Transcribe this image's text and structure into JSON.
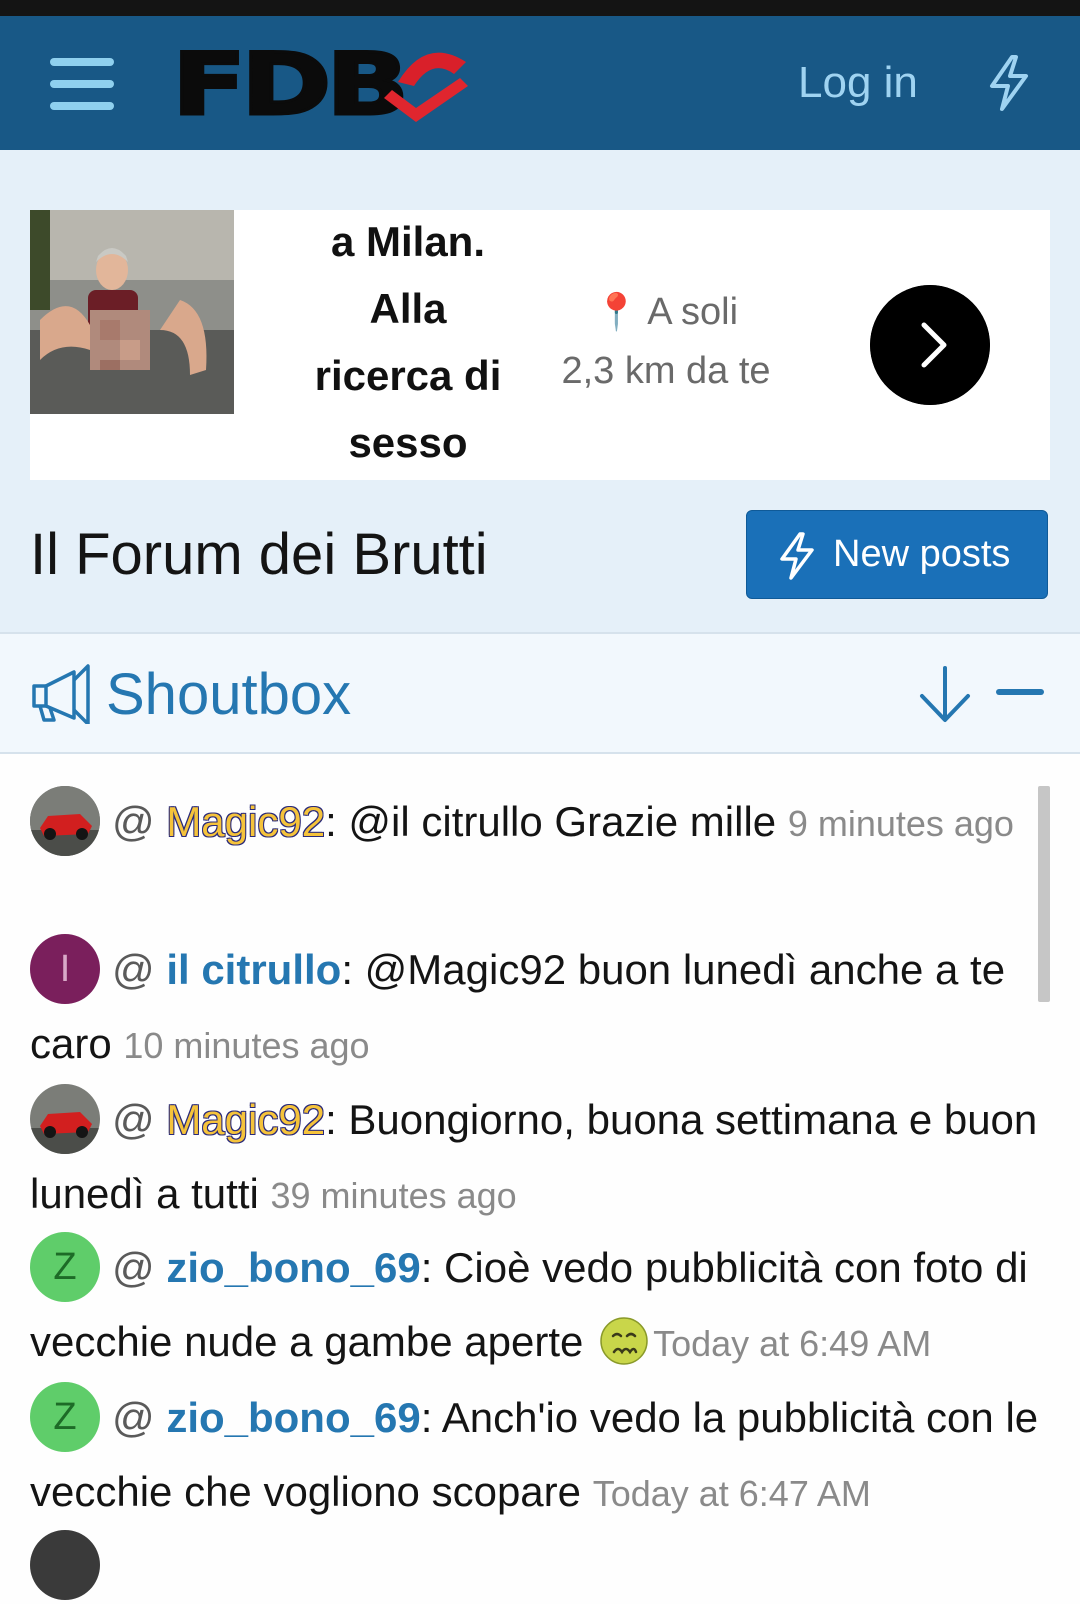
{
  "header": {
    "logo_text": "FDB",
    "login_label": "Log in",
    "menu_icon": "hamburger-menu-icon",
    "whats_new_icon": "lightning-bolt-icon"
  },
  "ad": {
    "headline_lines": [
      "a Milan.",
      "Alla",
      "ricerca di",
      "sesso"
    ],
    "location_label": "A soli",
    "distance": "2,3 km da te",
    "pin_icon": "📍"
  },
  "page": {
    "title": "Il Forum dei Brutti",
    "new_posts_label": "New posts"
  },
  "shoutbox": {
    "title": "Shoutbox",
    "messages": [
      {
        "avatar_letter": "",
        "at": "@",
        "user": "Magic92",
        "sep": ":",
        "text": " @il citrullo Grazie mille ",
        "time": "9 minutes ago"
      },
      {
        "avatar_letter": "I",
        "at": "@",
        "user": "il citrullo",
        "sep": ":",
        "text": " @Magic92 buon lunedì anche a te caro ",
        "time": "10 minutes ago"
      },
      {
        "avatar_letter": "",
        "at": "@",
        "user": "Magic92",
        "sep": ":",
        "text": " Buongiorno, buona settimana e buon lunedì a tutti ",
        "time": "39 minutes ago"
      },
      {
        "avatar_letter": "Z",
        "at": "@",
        "user": "zio_bono_69",
        "sep": ":",
        "text": " Cioè vedo pubblicità con foto di vecchie nude a gambe aperte ",
        "time": "Today at 6:49 AM"
      },
      {
        "avatar_letter": "Z",
        "at": "@",
        "user": "zio_bono_69",
        "sep": ":",
        "text": " Anch'io vedo la pubblicità con le vecchie che vogliono scopare ",
        "time": "Today at 6:47 AM"
      }
    ]
  },
  "colors": {
    "header_bg": "#185886",
    "accent_blue": "#2577b1",
    "button_blue": "#1a70b8",
    "page_bg": "#e5f0f9"
  }
}
